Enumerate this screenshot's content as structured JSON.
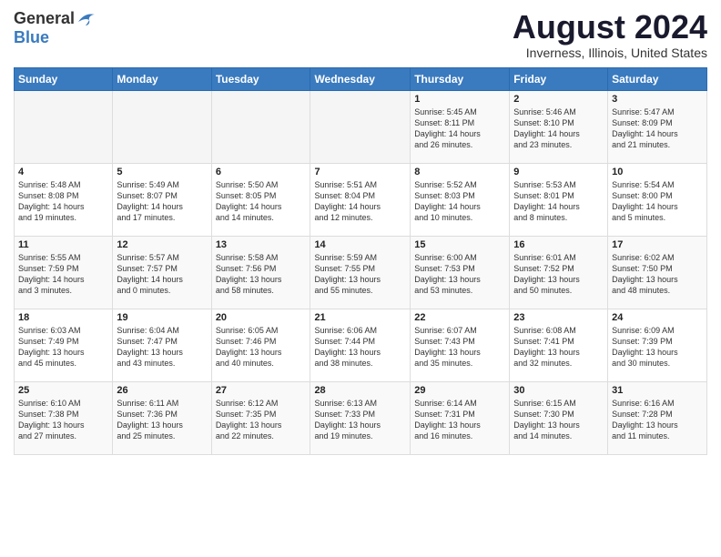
{
  "header": {
    "logo_general": "General",
    "logo_blue": "Blue",
    "month_title": "August 2024",
    "location": "Inverness, Illinois, United States"
  },
  "days_of_week": [
    "Sunday",
    "Monday",
    "Tuesday",
    "Wednesday",
    "Thursday",
    "Friday",
    "Saturday"
  ],
  "weeks": [
    [
      {
        "day": "",
        "info": ""
      },
      {
        "day": "",
        "info": ""
      },
      {
        "day": "",
        "info": ""
      },
      {
        "day": "",
        "info": ""
      },
      {
        "day": "1",
        "info": "Sunrise: 5:45 AM\nSunset: 8:11 PM\nDaylight: 14 hours\nand 26 minutes."
      },
      {
        "day": "2",
        "info": "Sunrise: 5:46 AM\nSunset: 8:10 PM\nDaylight: 14 hours\nand 23 minutes."
      },
      {
        "day": "3",
        "info": "Sunrise: 5:47 AM\nSunset: 8:09 PM\nDaylight: 14 hours\nand 21 minutes."
      }
    ],
    [
      {
        "day": "4",
        "info": "Sunrise: 5:48 AM\nSunset: 8:08 PM\nDaylight: 14 hours\nand 19 minutes."
      },
      {
        "day": "5",
        "info": "Sunrise: 5:49 AM\nSunset: 8:07 PM\nDaylight: 14 hours\nand 17 minutes."
      },
      {
        "day": "6",
        "info": "Sunrise: 5:50 AM\nSunset: 8:05 PM\nDaylight: 14 hours\nand 14 minutes."
      },
      {
        "day": "7",
        "info": "Sunrise: 5:51 AM\nSunset: 8:04 PM\nDaylight: 14 hours\nand 12 minutes."
      },
      {
        "day": "8",
        "info": "Sunrise: 5:52 AM\nSunset: 8:03 PM\nDaylight: 14 hours\nand 10 minutes."
      },
      {
        "day": "9",
        "info": "Sunrise: 5:53 AM\nSunset: 8:01 PM\nDaylight: 14 hours\nand 8 minutes."
      },
      {
        "day": "10",
        "info": "Sunrise: 5:54 AM\nSunset: 8:00 PM\nDaylight: 14 hours\nand 5 minutes."
      }
    ],
    [
      {
        "day": "11",
        "info": "Sunrise: 5:55 AM\nSunset: 7:59 PM\nDaylight: 14 hours\nand 3 minutes."
      },
      {
        "day": "12",
        "info": "Sunrise: 5:57 AM\nSunset: 7:57 PM\nDaylight: 14 hours\nand 0 minutes."
      },
      {
        "day": "13",
        "info": "Sunrise: 5:58 AM\nSunset: 7:56 PM\nDaylight: 13 hours\nand 58 minutes."
      },
      {
        "day": "14",
        "info": "Sunrise: 5:59 AM\nSunset: 7:55 PM\nDaylight: 13 hours\nand 55 minutes."
      },
      {
        "day": "15",
        "info": "Sunrise: 6:00 AM\nSunset: 7:53 PM\nDaylight: 13 hours\nand 53 minutes."
      },
      {
        "day": "16",
        "info": "Sunrise: 6:01 AM\nSunset: 7:52 PM\nDaylight: 13 hours\nand 50 minutes."
      },
      {
        "day": "17",
        "info": "Sunrise: 6:02 AM\nSunset: 7:50 PM\nDaylight: 13 hours\nand 48 minutes."
      }
    ],
    [
      {
        "day": "18",
        "info": "Sunrise: 6:03 AM\nSunset: 7:49 PM\nDaylight: 13 hours\nand 45 minutes."
      },
      {
        "day": "19",
        "info": "Sunrise: 6:04 AM\nSunset: 7:47 PM\nDaylight: 13 hours\nand 43 minutes."
      },
      {
        "day": "20",
        "info": "Sunrise: 6:05 AM\nSunset: 7:46 PM\nDaylight: 13 hours\nand 40 minutes."
      },
      {
        "day": "21",
        "info": "Sunrise: 6:06 AM\nSunset: 7:44 PM\nDaylight: 13 hours\nand 38 minutes."
      },
      {
        "day": "22",
        "info": "Sunrise: 6:07 AM\nSunset: 7:43 PM\nDaylight: 13 hours\nand 35 minutes."
      },
      {
        "day": "23",
        "info": "Sunrise: 6:08 AM\nSunset: 7:41 PM\nDaylight: 13 hours\nand 32 minutes."
      },
      {
        "day": "24",
        "info": "Sunrise: 6:09 AM\nSunset: 7:39 PM\nDaylight: 13 hours\nand 30 minutes."
      }
    ],
    [
      {
        "day": "25",
        "info": "Sunrise: 6:10 AM\nSunset: 7:38 PM\nDaylight: 13 hours\nand 27 minutes."
      },
      {
        "day": "26",
        "info": "Sunrise: 6:11 AM\nSunset: 7:36 PM\nDaylight: 13 hours\nand 25 minutes."
      },
      {
        "day": "27",
        "info": "Sunrise: 6:12 AM\nSunset: 7:35 PM\nDaylight: 13 hours\nand 22 minutes."
      },
      {
        "day": "28",
        "info": "Sunrise: 6:13 AM\nSunset: 7:33 PM\nDaylight: 13 hours\nand 19 minutes."
      },
      {
        "day": "29",
        "info": "Sunrise: 6:14 AM\nSunset: 7:31 PM\nDaylight: 13 hours\nand 16 minutes."
      },
      {
        "day": "30",
        "info": "Sunrise: 6:15 AM\nSunset: 7:30 PM\nDaylight: 13 hours\nand 14 minutes."
      },
      {
        "day": "31",
        "info": "Sunrise: 6:16 AM\nSunset: 7:28 PM\nDaylight: 13 hours\nand 11 minutes."
      }
    ]
  ]
}
